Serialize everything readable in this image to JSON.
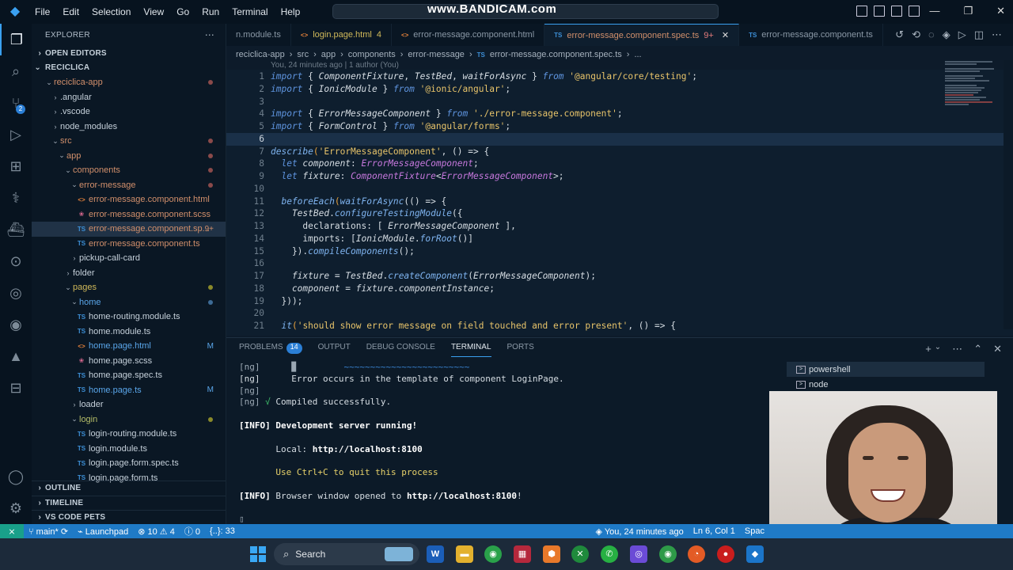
{
  "titlebar": {
    "menu": [
      "File",
      "Edit",
      "Selection",
      "View",
      "Go",
      "Run",
      "Terminal",
      "Help"
    ],
    "watermark": "www.BANDICAM.com"
  },
  "explorer": {
    "title": "EXPLORER",
    "open_editors": "OPEN EDITORS",
    "root": "RECICLICA",
    "tree": [
      {
        "label": "reciclica-app",
        "kind": "folder",
        "open": true,
        "indent": 1,
        "color": "git",
        "dot": "red"
      },
      {
        "label": ".angular",
        "kind": "folder",
        "open": false,
        "indent": 2
      },
      {
        "label": ".vscode",
        "kind": "folder",
        "open": false,
        "indent": 2
      },
      {
        "label": "node_modules",
        "kind": "folder",
        "open": false,
        "indent": 2
      },
      {
        "label": "src",
        "kind": "folder",
        "open": true,
        "indent": 2,
        "color": "git",
        "dot": "red"
      },
      {
        "label": "app",
        "kind": "folder",
        "open": true,
        "indent": 3,
        "color": "git",
        "dot": "red"
      },
      {
        "label": "components",
        "kind": "folder",
        "open": true,
        "indent": 4,
        "color": "git",
        "dot": "red"
      },
      {
        "label": "error-message",
        "kind": "folder",
        "open": true,
        "indent": 5,
        "color": "git",
        "dot": "red"
      },
      {
        "label": "error-message.component.html",
        "kind": "html",
        "indent": 6,
        "color": "git"
      },
      {
        "label": "error-message.component.scss",
        "kind": "scss",
        "indent": 6,
        "color": "git"
      },
      {
        "label": "error-message.component.sp...",
        "kind": "ts",
        "indent": 6,
        "color": "git",
        "flag": "9+",
        "selected": true
      },
      {
        "label": "error-message.component.ts",
        "kind": "ts",
        "indent": 6,
        "color": "git"
      },
      {
        "label": "pickup-call-card",
        "kind": "folder",
        "open": false,
        "indent": 5
      },
      {
        "label": "folder",
        "kind": "folder",
        "open": false,
        "indent": 4
      },
      {
        "label": "pages",
        "kind": "folder",
        "open": true,
        "indent": 4,
        "color": "mod",
        "dot": "yellow"
      },
      {
        "label": "home",
        "kind": "folder",
        "open": true,
        "indent": 5,
        "color": "blue",
        "dot": "blue"
      },
      {
        "label": "home-routing.module.ts",
        "kind": "ts",
        "indent": 6
      },
      {
        "label": "home.module.ts",
        "kind": "ts",
        "indent": 6
      },
      {
        "label": "home.page.html",
        "kind": "html",
        "indent": 6,
        "color": "blue",
        "flag": "M"
      },
      {
        "label": "home.page.scss",
        "kind": "scss",
        "indent": 6
      },
      {
        "label": "home.page.spec.ts",
        "kind": "ts",
        "indent": 6
      },
      {
        "label": "home.page.ts",
        "kind": "ts",
        "indent": 6,
        "color": "blue",
        "flag": "M"
      },
      {
        "label": "loader",
        "kind": "folder",
        "open": false,
        "indent": 5
      },
      {
        "label": "login",
        "kind": "folder",
        "open": true,
        "indent": 5,
        "color": "green",
        "dot": "yellow"
      },
      {
        "label": "login-routing.module.ts",
        "kind": "ts",
        "indent": 6
      },
      {
        "label": "login.module.ts",
        "kind": "ts",
        "indent": 6
      },
      {
        "label": "login.page.form.spec.ts",
        "kind": "ts",
        "indent": 6
      },
      {
        "label": "login.page.form.ts",
        "kind": "ts",
        "indent": 6
      }
    ],
    "outline": "OUTLINE",
    "timeline": "TIMELINE",
    "pets": "VS CODE PETS"
  },
  "tabs": [
    {
      "label": "n.module.ts",
      "kind": "",
      "active": false
    },
    {
      "label": "login.page.html",
      "kind": "html",
      "badge": "4",
      "active": false
    },
    {
      "label": "error-message.component.html",
      "kind": "html",
      "active": false
    },
    {
      "label": "error-message.component.spec.ts",
      "kind": "ts",
      "badge": "9+",
      "active": true
    },
    {
      "label": "error-message.component.ts",
      "kind": "ts",
      "active": false
    }
  ],
  "breadcrumb": [
    "reciclica-app",
    "src",
    "app",
    "components",
    "error-message",
    "error-message.component.spec.ts",
    "..."
  ],
  "blame": "You, 24 minutes ago | 1 author (You)",
  "code": [
    [
      {
        "t": "import",
        "c": "kw"
      },
      {
        "t": " { ",
        "c": "pl"
      },
      {
        "t": "ComponentFixture",
        "c": "id"
      },
      {
        "t": ", ",
        "c": "pl"
      },
      {
        "t": "TestBed",
        "c": "id"
      },
      {
        "t": ", ",
        "c": "pl"
      },
      {
        "t": "waitForAsync",
        "c": "id"
      },
      {
        "t": " } ",
        "c": "pl"
      },
      {
        "t": "from",
        "c": "kw"
      },
      {
        "t": " '@angular/core/testing'",
        "c": "str"
      },
      {
        "t": ";",
        "c": "pl"
      }
    ],
    [
      {
        "t": "import",
        "c": "kw"
      },
      {
        "t": " { ",
        "c": "pl"
      },
      {
        "t": "IonicModule",
        "c": "id"
      },
      {
        "t": " } ",
        "c": "pl"
      },
      {
        "t": "from",
        "c": "kw"
      },
      {
        "t": " '@ionic/angular'",
        "c": "str"
      },
      {
        "t": ";",
        "c": "pl"
      }
    ],
    [],
    [
      {
        "t": "import",
        "c": "kw"
      },
      {
        "t": " { ",
        "c": "pl"
      },
      {
        "t": "ErrorMessageComponent",
        "c": "id"
      },
      {
        "t": " } ",
        "c": "pl"
      },
      {
        "t": "from",
        "c": "kw"
      },
      {
        "t": " './error-message.component'",
        "c": "str"
      },
      {
        "t": ";",
        "c": "pl"
      }
    ],
    [
      {
        "t": "import",
        "c": "kw"
      },
      {
        "t": " { ",
        "c": "pl"
      },
      {
        "t": "FormControl",
        "c": "id"
      },
      {
        "t": " } ",
        "c": "pl"
      },
      {
        "t": "from",
        "c": "kw"
      },
      {
        "t": " '@angular/forms'",
        "c": "str"
      },
      {
        "t": ";",
        "c": "pl"
      }
    ],
    [],
    [
      {
        "t": "describe",
        "c": "fn"
      },
      {
        "t": "(",
        "c": "pr"
      },
      {
        "t": "'ErrorMessageComponent'",
        "c": "str"
      },
      {
        "t": ", () => {",
        "c": "pl"
      }
    ],
    [
      {
        "t": "  let ",
        "c": "kw"
      },
      {
        "t": "component",
        "c": "id"
      },
      {
        "t": ": ",
        "c": "pl"
      },
      {
        "t": "ErrorMessageComponent",
        "c": "ty"
      },
      {
        "t": ";",
        "c": "pl"
      }
    ],
    [
      {
        "t": "  let ",
        "c": "kw"
      },
      {
        "t": "fixture",
        "c": "id"
      },
      {
        "t": ": ",
        "c": "pl"
      },
      {
        "t": "ComponentFixture",
        "c": "ty"
      },
      {
        "t": "<",
        "c": "pl"
      },
      {
        "t": "ErrorMessageComponent",
        "c": "ty"
      },
      {
        "t": ">;",
        "c": "pl"
      }
    ],
    [],
    [
      {
        "t": "  beforeEach",
        "c": "fn"
      },
      {
        "t": "(",
        "c": "pr"
      },
      {
        "t": "waitForAsync",
        "c": "fn"
      },
      {
        "t": "(() => {",
        "c": "pl"
      }
    ],
    [
      {
        "t": "    TestBed",
        "c": "id"
      },
      {
        "t": ".",
        "c": "pl"
      },
      {
        "t": "configureTestingModule",
        "c": "fn"
      },
      {
        "t": "({",
        "c": "pl"
      }
    ],
    [
      {
        "t": "      declarations: [ ",
        "c": "pl"
      },
      {
        "t": "ErrorMessageComponent",
        "c": "id"
      },
      {
        "t": " ],",
        "c": "pl"
      }
    ],
    [
      {
        "t": "      imports: [",
        "c": "pl"
      },
      {
        "t": "IonicModule",
        "c": "id"
      },
      {
        "t": ".",
        "c": "pl"
      },
      {
        "t": "forRoot",
        "c": "fn"
      },
      {
        "t": "()]",
        "c": "pl"
      }
    ],
    [
      {
        "t": "    }).",
        "c": "pl"
      },
      {
        "t": "compileComponents",
        "c": "fn"
      },
      {
        "t": "();",
        "c": "pl"
      }
    ],
    [],
    [
      {
        "t": "    fixture",
        "c": "id"
      },
      {
        "t": " = ",
        "c": "pl"
      },
      {
        "t": "TestBed",
        "c": "id"
      },
      {
        "t": ".",
        "c": "pl"
      },
      {
        "t": "createComponent",
        "c": "fn"
      },
      {
        "t": "(",
        "c": "pl"
      },
      {
        "t": "ErrorMessageComponent",
        "c": "id"
      },
      {
        "t": ");",
        "c": "pl"
      }
    ],
    [
      {
        "t": "    component",
        "c": "id"
      },
      {
        "t": " = ",
        "c": "pl"
      },
      {
        "t": "fixture",
        "c": "id"
      },
      {
        "t": ".",
        "c": "pl"
      },
      {
        "t": "componentInstance",
        "c": "id"
      },
      {
        "t": ";",
        "c": "pl"
      }
    ],
    [
      {
        "t": "  }));",
        "c": "pl"
      }
    ],
    [],
    [
      {
        "t": "  it",
        "c": "fn"
      },
      {
        "t": "(",
        "c": "pr"
      },
      {
        "t": "'should show error message on field touched and error present'",
        "c": "str"
      },
      {
        "t": ", () => {",
        "c": "pl"
      }
    ]
  ],
  "current_line": 6,
  "panel": {
    "tabs": [
      "PROBLEMS",
      "OUTPUT",
      "DEBUG CONSOLE",
      "TERMINAL",
      "PORTS"
    ],
    "problems_count": "14",
    "active_tab": "TERMINAL",
    "terminal_lines": [
      {
        "parts": [
          {
            "t": "[ng]      ",
            "c": "t-dim"
          },
          {
            "t": "▉",
            "c": "t-dim"
          },
          {
            "t": "         ~~~~~~~~~~~~~~~~~~~~~~~~",
            "c": "t-squig"
          }
        ]
      },
      {
        "parts": [
          {
            "t": "[ng]      Error occurs in the template of component LoginPage.",
            "c": ""
          }
        ]
      },
      {
        "parts": [
          {
            "t": "[ng]",
            "c": "t-dim"
          }
        ]
      },
      {
        "parts": [
          {
            "t": "[ng] ",
            "c": "t-dim"
          },
          {
            "t": "√",
            "c": "t-green"
          },
          {
            "t": " Compiled successfully.",
            "c": ""
          }
        ]
      },
      {
        "parts": [
          {
            "t": "",
            "c": ""
          }
        ]
      },
      {
        "parts": [
          {
            "t": "[INFO] ",
            "c": "t-bold"
          },
          {
            "t": "Development server running!",
            "c": "t-bold"
          }
        ]
      },
      {
        "parts": [
          {
            "t": "",
            "c": ""
          }
        ]
      },
      {
        "parts": [
          {
            "t": "       Local: ",
            "c": ""
          },
          {
            "t": "http://localhost:8100",
            "c": "t-bold"
          }
        ]
      },
      {
        "parts": [
          {
            "t": "",
            "c": ""
          }
        ]
      },
      {
        "parts": [
          {
            "t": "       Use Ctrl+C to quit this process",
            "c": "t-yellow"
          }
        ]
      },
      {
        "parts": [
          {
            "t": "",
            "c": ""
          }
        ]
      },
      {
        "parts": [
          {
            "t": "[INFO] ",
            "c": "t-bold"
          },
          {
            "t": "Browser window opened to ",
            "c": ""
          },
          {
            "t": "http://localhost:8100",
            "c": "t-bold"
          },
          {
            "t": "!",
            "c": ""
          }
        ]
      },
      {
        "parts": [
          {
            "t": "",
            "c": ""
          }
        ]
      },
      {
        "parts": [
          {
            "t": "▯",
            "c": "t-dim"
          }
        ]
      }
    ],
    "terminals": [
      "powershell",
      "node"
    ]
  },
  "statusbar": {
    "branch": "main*",
    "launchpad": "Launchpad",
    "errors": "10",
    "warnings": "4",
    "info": "0",
    "selection": "{..}: 33",
    "blame": "You, 24 minutes ago",
    "position": "Ln 6, Col 1",
    "spaces": "Spac"
  },
  "taskbar": {
    "search": "Search"
  }
}
